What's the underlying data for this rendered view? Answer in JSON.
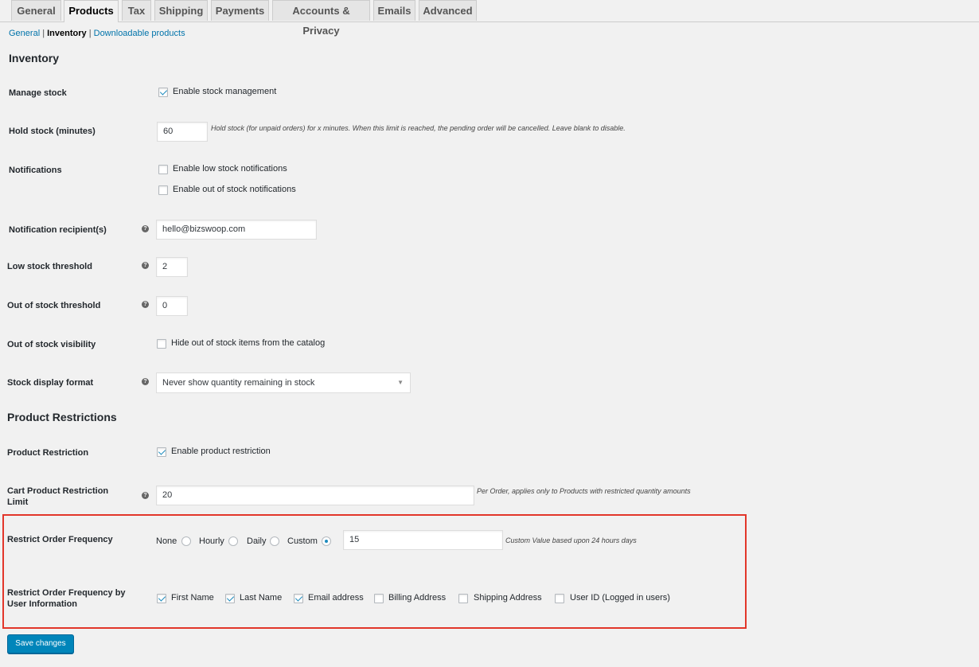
{
  "tabs": [
    "General",
    "Products",
    "Tax",
    "Shipping",
    "Payments",
    "Accounts & Privacy",
    "Emails",
    "Advanced"
  ],
  "active_tab": "Products",
  "subnav": {
    "general": "General",
    "separator1": "|",
    "inventory": "Inventory",
    "separator2": "|",
    "downloadable": "Downloadable products"
  },
  "inventory": {
    "heading": "Inventory",
    "manage_stock": {
      "label": "Manage stock",
      "checkbox_label": "Enable stock management",
      "checked": true
    },
    "hold_stock": {
      "label": "Hold stock (minutes)",
      "value": "60",
      "description": "Hold stock (for unpaid orders) for x minutes. When this limit is reached, the pending order will be cancelled. Leave blank to disable."
    },
    "notifications": {
      "label": "Notifications",
      "low_stock": "Enable low stock notifications",
      "out_of_stock": "Enable out of stock notifications"
    },
    "recipient": {
      "label": "Notification recipient(s)",
      "value": "hello@bizswoop.com"
    },
    "low_threshold": {
      "label": "Low stock threshold",
      "value": "2"
    },
    "out_threshold": {
      "label": "Out of stock threshold",
      "value": "0"
    },
    "visibility": {
      "label": "Out of stock visibility",
      "checkbox_label": "Hide out of stock items from the catalog"
    },
    "display_format": {
      "label": "Stock display format",
      "selected": "Never show quantity remaining in stock"
    }
  },
  "restrictions": {
    "heading": "Product Restrictions",
    "product_restriction": {
      "label": "Product Restriction",
      "checkbox_label": "Enable product restriction",
      "checked": true
    },
    "cart_limit": {
      "label_line1": "Cart Product Restriction",
      "label_line2": "Limit",
      "value": "20",
      "description": "Per Order, applies only to Products with restricted quantity amounts"
    },
    "frequency": {
      "label": "Restrict Order Frequency",
      "options": [
        "None",
        "Hourly",
        "Daily",
        "Custom"
      ],
      "selected": "Custom",
      "custom_value": "15",
      "description": "Custom Value based upon 24 hours days"
    },
    "by_user": {
      "label_line1": "Restrict Order Frequency by",
      "label_line2": "User Information",
      "first_name": "First Name",
      "last_name": "Last Name",
      "email": "Email address",
      "billing": "Billing Address",
      "shipping": "Shipping Address",
      "user_id": "User ID (Logged in users)"
    }
  },
  "save_label": "Save changes",
  "help_glyph": "?",
  "colors": {
    "accent": "#0085ba",
    "link": "#0073aa",
    "highlight_border": "#e2362a"
  }
}
